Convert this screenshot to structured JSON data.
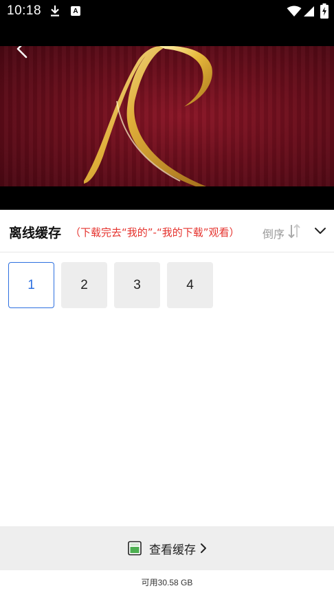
{
  "status_bar": {
    "time": "10:18",
    "icons": [
      "download-icon",
      "a-letter-icon",
      "wifi-icon",
      "signal-icon",
      "battery-icon"
    ],
    "a_letter": "A"
  },
  "player": {
    "back_icon": "chevron-left-icon"
  },
  "header": {
    "title": "离线缓存",
    "hint": "（下载完去“我的”-“我的下载”观看）",
    "sort_label": "倒序",
    "sort_icon": "sort-arrows-icon",
    "collapse_icon": "chevron-down-icon"
  },
  "episodes": [
    {
      "label": "1",
      "selected": true
    },
    {
      "label": "2",
      "selected": false
    },
    {
      "label": "3",
      "selected": false
    },
    {
      "label": "4",
      "selected": false
    }
  ],
  "bottom": {
    "cache_label": "查看缓存",
    "cache_icon": "sd-card-icon",
    "storage_text": "可用30.58 GB"
  },
  "colors": {
    "accent_blue": "#2c6fe0",
    "hint_red": "#e5322d",
    "tile_gray": "#ededed"
  }
}
